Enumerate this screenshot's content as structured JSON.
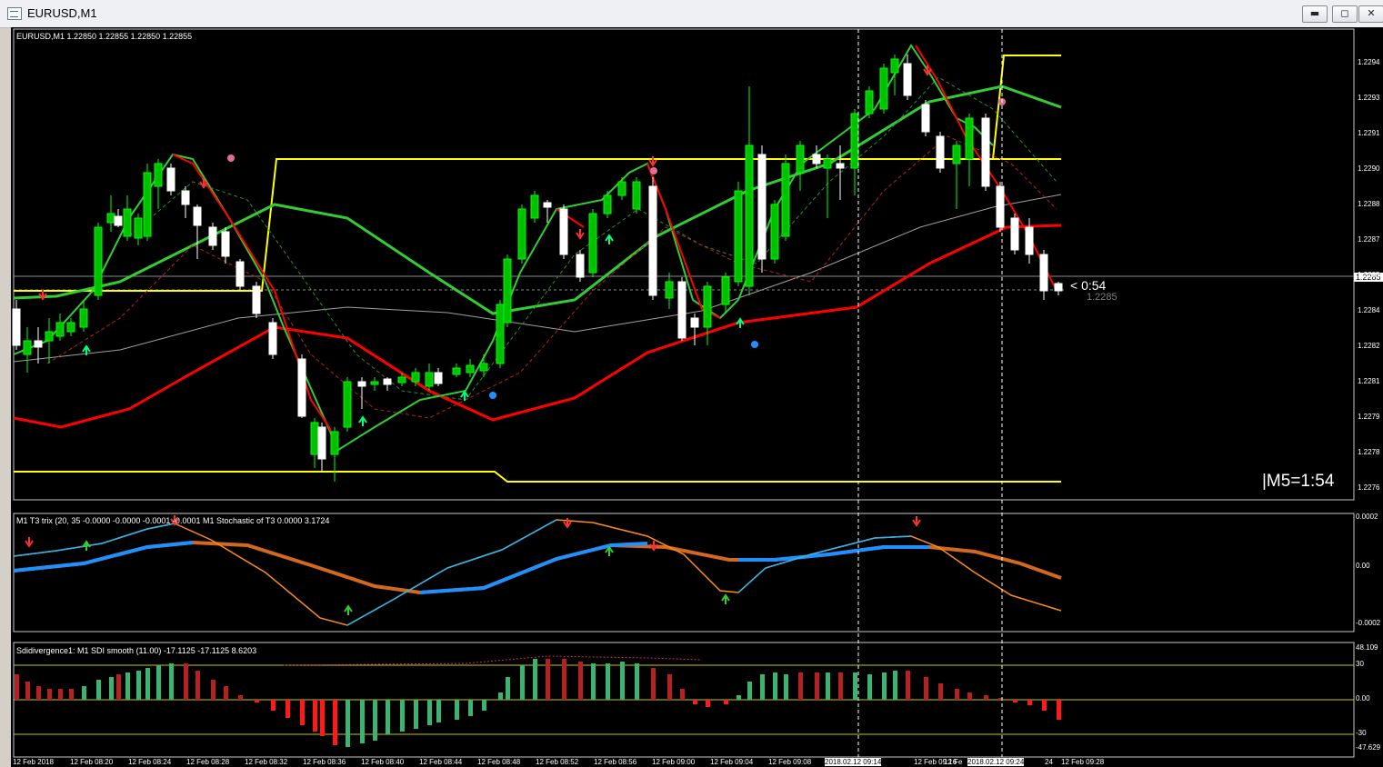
{
  "window": {
    "title": "EURUSD,M1",
    "minimize_glyph": "▬",
    "maximize_glyph": "◻",
    "close_glyph": "✕"
  },
  "main_chart": {
    "header": "EURUSD,M1  1.22850 1.22855 1.22850 1.22855",
    "countdown": "< 0:54",
    "bid_label": "1.2285",
    "current_price_tag": "1.2285",
    "m5_timer": "|M5=1:54",
    "price_axis": [
      "1.2294",
      "1.2293",
      "1.2291",
      "1.2290",
      "1.2288",
      "1.2287",
      "1.2285",
      "1.2284",
      "1.2282",
      "1.2281",
      "1.2279",
      "1.2278",
      "1.2276"
    ],
    "colors": {
      "bull": "#00ff00",
      "bear": "#ffffff",
      "ma_green": "#32cd32",
      "ma_red": "#ff0000",
      "channel": "#ffff00",
      "ma_gray": "#a0a0a0"
    }
  },
  "trix_panel": {
    "header": "M1 T3 trix (20, 35 -0.0000 -0.0000 -0.0001 -0.0001  M1    Stochastic of T3 0.0000 3.1724",
    "axis": [
      "0.0002",
      "0.00",
      "-0.0002"
    ]
  },
  "sdi_panel": {
    "header": "Sdidivergence1:  M1    SDI smooth (11.00) -17.1125 -17.1125 8.6203",
    "axis": [
      "48.109",
      "30",
      "0.00",
      "-30",
      "-47.629"
    ]
  },
  "time_axis": {
    "labels": [
      "12 Feb 2018",
      "12 Feb 08:20",
      "12 Feb 08:24",
      "12 Feb 08:28",
      "12 Feb 08:32",
      "12 Feb 08:36",
      "12 Feb 08:40",
      "12 Feb 08:44",
      "12 Feb 08:48",
      "12 Feb 08:52",
      "12 Feb 08:56",
      "12 Feb 09:00",
      "12 Feb 09:04",
      "12 Feb 09:08",
      "12 Feb 09:16",
      "12 Feb 09:28"
    ],
    "highlights": [
      "2018.02.12 09:14",
      "2018.02.12 09:24"
    ],
    "fragments": [
      "12 Fe",
      "24"
    ]
  }
}
